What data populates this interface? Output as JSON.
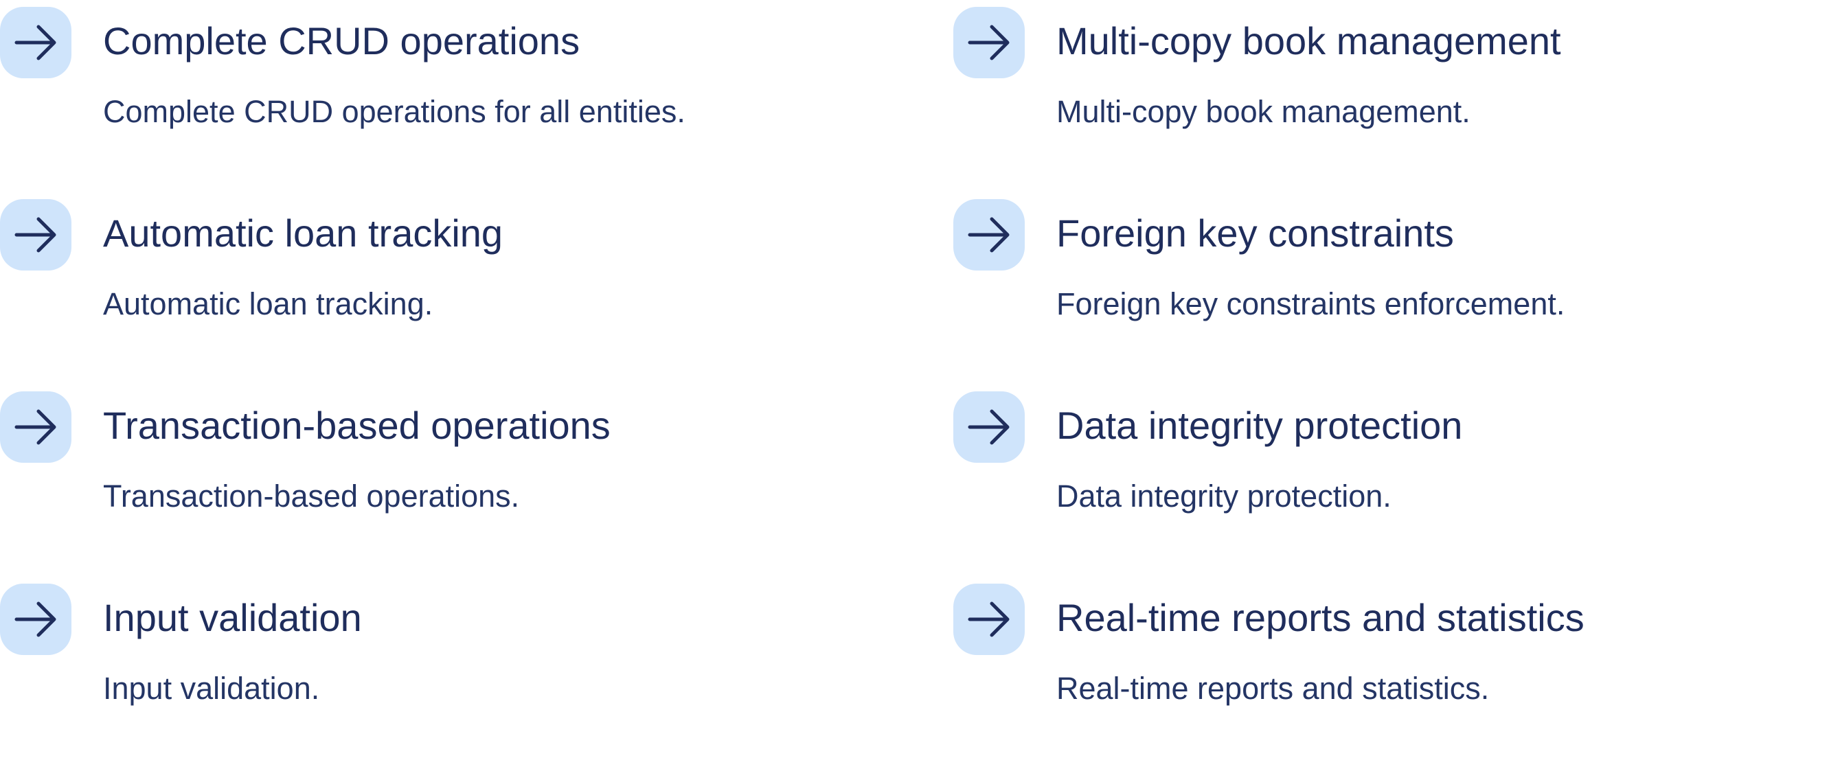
{
  "theme": {
    "icon_background": "#cfe4fb",
    "icon_color": "#1f2d5c",
    "title_color": "#1f2d5c",
    "description_color": "#243565"
  },
  "features": [
    {
      "icon": "arrow-right-icon",
      "title": "Complete CRUD operations",
      "description": "Complete CRUD operations for all entities."
    },
    {
      "icon": "arrow-right-icon",
      "title": "Multi-copy book management",
      "description": "Multi-copy book management."
    },
    {
      "icon": "arrow-right-icon",
      "title": "Automatic loan tracking",
      "description": "Automatic loan tracking."
    },
    {
      "icon": "arrow-right-icon",
      "title": "Foreign key constraints",
      "description": "Foreign key constraints enforcement."
    },
    {
      "icon": "arrow-right-icon",
      "title": "Transaction-based operations",
      "description": "Transaction-based operations."
    },
    {
      "icon": "arrow-right-icon",
      "title": "Data integrity protection",
      "description": "Data integrity protection."
    },
    {
      "icon": "arrow-right-icon",
      "title": "Input validation",
      "description": "Input validation."
    },
    {
      "icon": "arrow-right-icon",
      "title": "Real-time reports and statistics",
      "description": "Real-time reports and statistics."
    }
  ]
}
